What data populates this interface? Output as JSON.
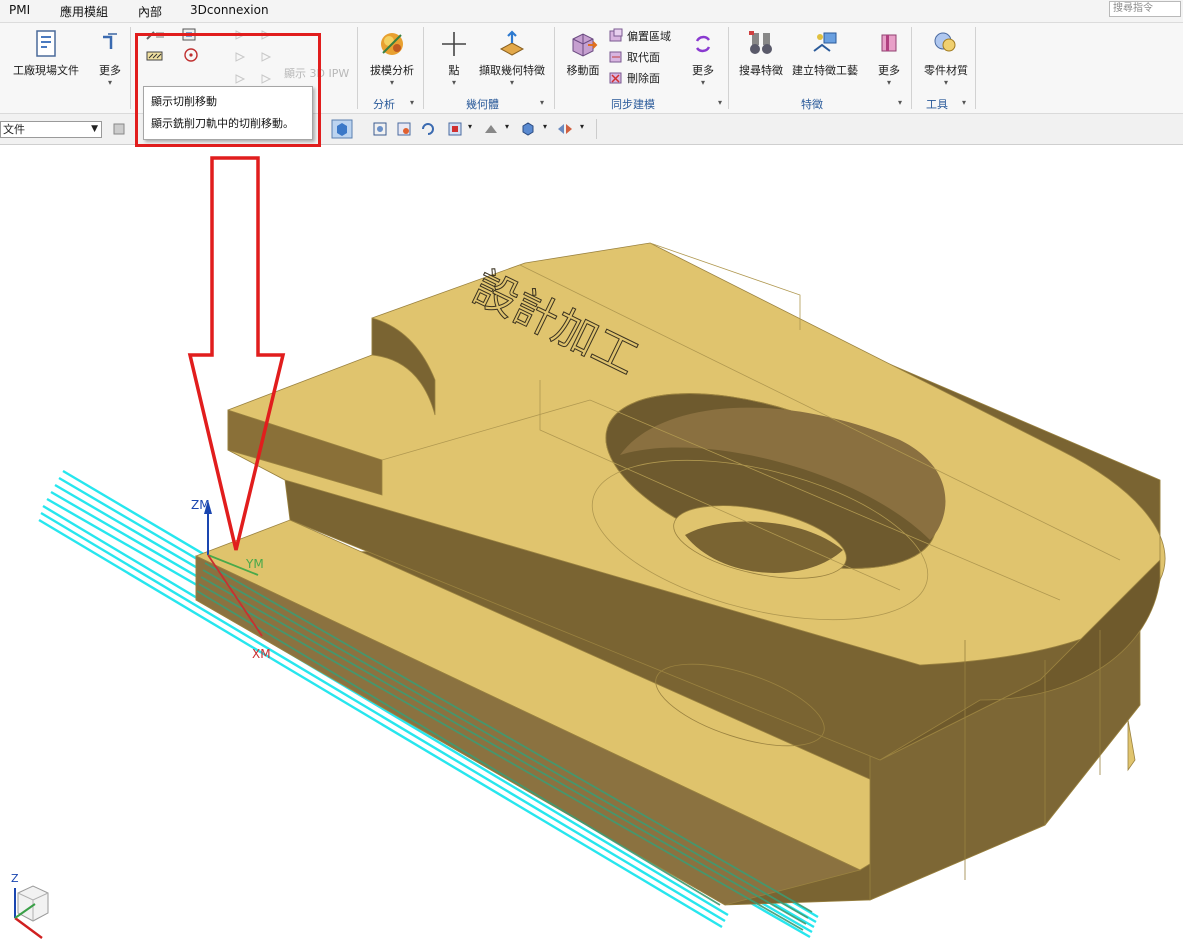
{
  "menubar": {
    "items": [
      "PMI",
      "應用模組",
      "內部",
      "3Dconnexion"
    ],
    "search_placeholder": "搜尋指令"
  },
  "ribbon": {
    "factory_doc": "工廠現場文件",
    "more": "更多",
    "show_3d_ipw": "顯示 3D IPW",
    "draft_analysis": "拔模分析",
    "point": "點",
    "extract_geometry": "擷取幾何特徵",
    "move_face": "移動面",
    "offset_region": "偏置區域",
    "replace_face": "取代面",
    "delete_face": "刪除面",
    "search_feature": "搜尋特徵",
    "create_feature_process": "建立特徵工藝",
    "part_material": "零件材質",
    "groups": {
      "analysis": "分析",
      "geometry": "幾何體",
      "sync_modeling": "同步建模",
      "feature": "特徵",
      "tools": "工具"
    }
  },
  "toolbar2": {
    "combo_value": "文件"
  },
  "tooltip": {
    "title": "顯示切削移動",
    "description": "顯示銑削刀軌中的切削移動。"
  },
  "viewport": {
    "engraved_text": "設計加工",
    "csys": {
      "zm": "ZM",
      "ym": "YM",
      "xm": "XM"
    },
    "triad": {
      "z": "Z"
    }
  },
  "colors": {
    "part_top": "#e0c46e",
    "part_side_dark": "#7a6432",
    "part_side_mid": "#8d7440",
    "toolpath": "#27e6ee",
    "highlight": "#e11d1d",
    "group_label": "#2a5a9a"
  }
}
